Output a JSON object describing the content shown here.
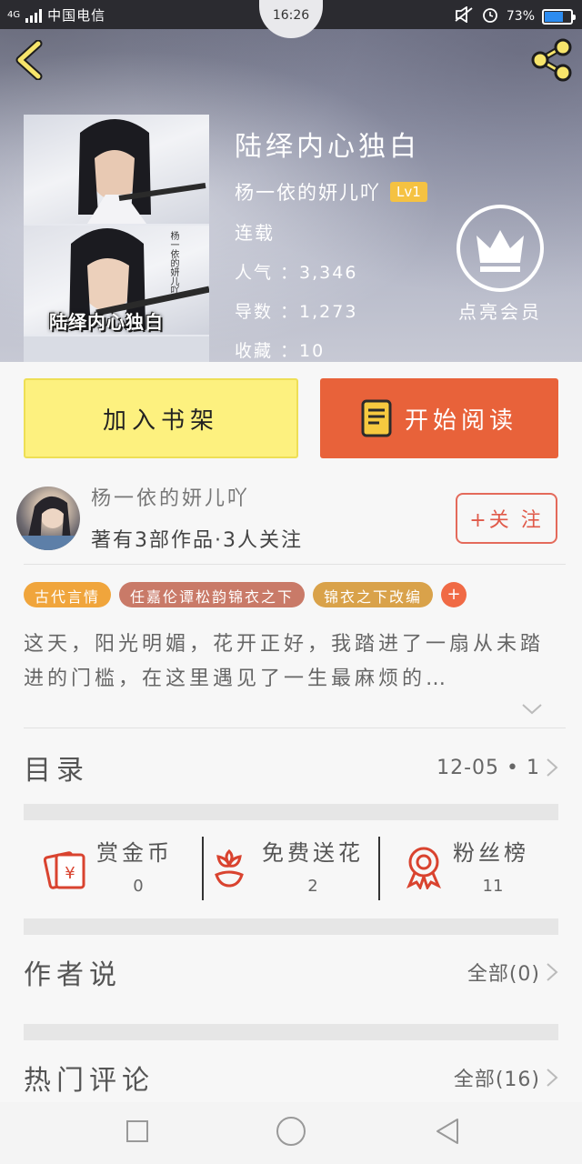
{
  "status_bar": {
    "network": "4G",
    "carrier": "中国电信",
    "time": "16:26",
    "battery": "73%",
    "battery_level": 0.73
  },
  "book": {
    "title": "陆绎内心独白",
    "author": "杨一依的妍儿吖",
    "level": "Lv1",
    "serial_status": "连载",
    "popularity": "人气 ：3,346",
    "guides": "导数 ：1,273",
    "favorites": "收藏 ：10",
    "cover_title": "陆绎内心独白",
    "cover_side_text": "杨一依的妍儿吖"
  },
  "vip": {
    "label": "点亮会员"
  },
  "actions": {
    "add_to_shelf": "加入书架",
    "start_reading": "开始阅读"
  },
  "author_block": {
    "name": "杨一依的妍儿吖",
    "meta": "著有3部作品·3人关注",
    "follow": "+关 注"
  },
  "tags": [
    {
      "label": "古代言情",
      "color": "#f0a53c"
    },
    {
      "label": "任嘉伦谭松韵锦衣之下",
      "color": "#c97a68"
    },
    {
      "label": "锦衣之下改编",
      "color": "#d9a24a"
    }
  ],
  "tag_add": "+",
  "summary": "这天，阳光明媚，花开正好，我踏进了一扇从未踏进的门槛，在这里遇见了一生最麻烦的…",
  "catalog": {
    "label": "目录",
    "value": "12-05 • 1"
  },
  "rewards": [
    {
      "label": "赏金币",
      "count": "0",
      "icon": "gold-coin-icon"
    },
    {
      "label": "免费送花",
      "count": "2",
      "icon": "flower-icon"
    },
    {
      "label": "粉丝榜",
      "count": "11",
      "icon": "medal-icon"
    }
  ],
  "author_says": {
    "label": "作者说",
    "value": "全部(0)"
  },
  "hot_comments": {
    "label": "热门评论",
    "value": "全部(16)"
  },
  "colors": {
    "accent_orange": "#e8623a",
    "shelf_yellow": "#fdf17f",
    "follow_red": "#e05a4a",
    "icon_red": "#d9432f"
  }
}
